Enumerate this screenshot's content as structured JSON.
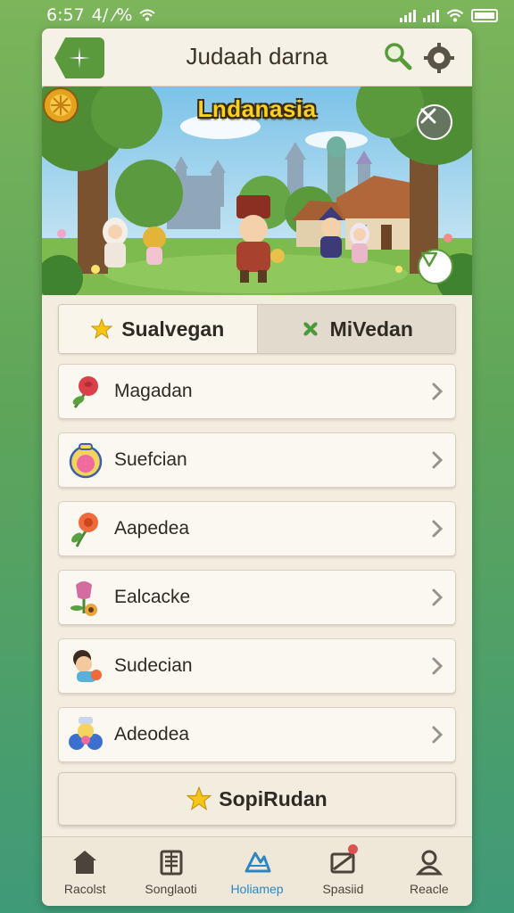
{
  "status": {
    "time": "6:57",
    "extra": "4/ ⁄%"
  },
  "header": {
    "title": "Judaah darna",
    "menu_icon": "sparkle-icon",
    "search_icon": "search-icon",
    "settings_icon": "gear-icon"
  },
  "banner": {
    "title": "Lndanasia"
  },
  "tabs": [
    {
      "label": "Sualvegan",
      "icon": "star-icon",
      "active": true
    },
    {
      "label": "MiVedan",
      "icon": "clover-icon",
      "active": false
    }
  ],
  "items": [
    {
      "label": "Magadan",
      "icon": "rose-icon"
    },
    {
      "label": "Suefcian",
      "icon": "ring-icon"
    },
    {
      "label": "Aapedea",
      "icon": "flower-icon"
    },
    {
      "label": "Ealcacke",
      "icon": "tulip-icon"
    },
    {
      "label": "Sudecian",
      "icon": "character-icon"
    },
    {
      "label": "Adeodea",
      "icon": "bouquet-icon"
    }
  ],
  "action": {
    "label": "SopiRudan",
    "icon": "star-icon"
  },
  "nav": [
    {
      "label": "Racolst",
      "icon": "home-icon"
    },
    {
      "label": "Songlaoti",
      "icon": "book-icon"
    },
    {
      "label": "Holiamep",
      "icon": "map-icon",
      "active": true
    },
    {
      "label": "Spasiid",
      "icon": "mail-icon",
      "badge": true
    },
    {
      "label": "Reacle",
      "icon": "profile-icon"
    }
  ],
  "colors": {
    "accent": "#5a9a3c",
    "active_nav": "#2e86c1",
    "banner_title": "#f7d21e",
    "badge": "#d9534f"
  }
}
